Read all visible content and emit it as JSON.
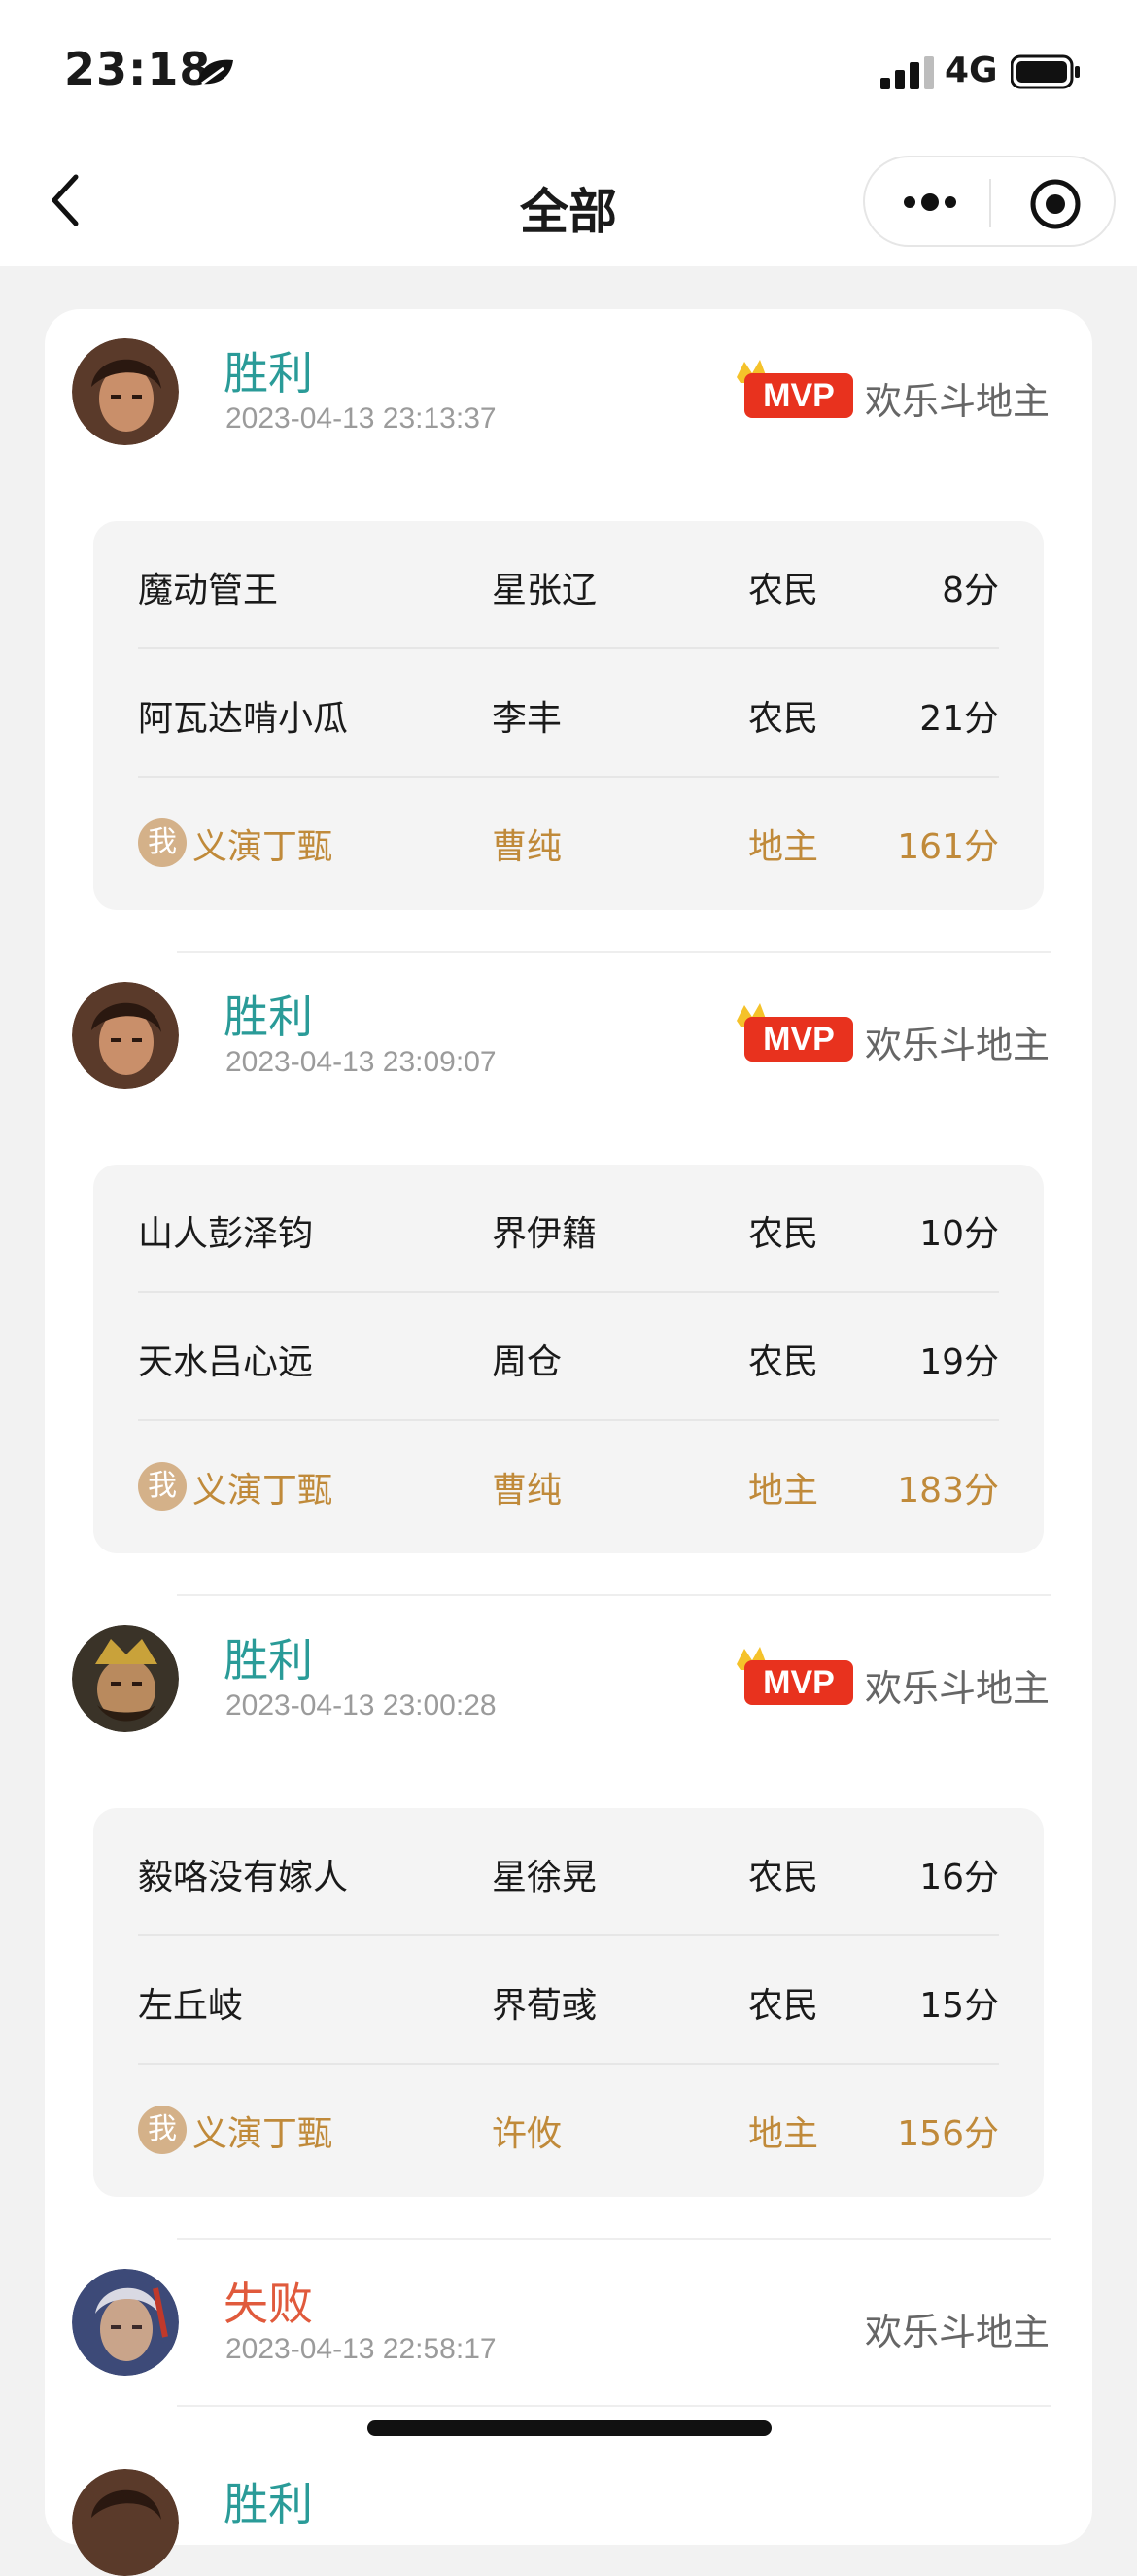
{
  "status_bar": {
    "time": "23:18",
    "network": "4G"
  },
  "nav": {
    "title": "全部"
  },
  "records": [
    {
      "result": "胜利",
      "result_type": "win",
      "datetime": "2023-04-13 23:13:37",
      "mvp": true,
      "mvp_label": "MVP",
      "mode": "欢乐斗地主",
      "rows": [
        {
          "name": "魔动管王",
          "hero": "星张辽",
          "role": "农民",
          "score": "8分"
        },
        {
          "name": "阿瓦达啃小瓜",
          "hero": "李丰",
          "role": "农民",
          "score": "21分"
        },
        {
          "me": "我",
          "name": "义演丁甄",
          "hero": "曹纯",
          "role": "地主",
          "score": "161分"
        }
      ]
    },
    {
      "result": "胜利",
      "result_type": "win",
      "datetime": "2023-04-13 23:09:07",
      "mvp": true,
      "mvp_label": "MVP",
      "mode": "欢乐斗地主",
      "rows": [
        {
          "name": "山人彭泽钧",
          "hero": "界伊籍",
          "role": "农民",
          "score": "10分"
        },
        {
          "name": "天水吕心远",
          "hero": "周仓",
          "role": "农民",
          "score": "19分"
        },
        {
          "me": "我",
          "name": "义演丁甄",
          "hero": "曹纯",
          "role": "地主",
          "score": "183分"
        }
      ]
    },
    {
      "result": "胜利",
      "result_type": "win",
      "datetime": "2023-04-13 23:00:28",
      "mvp": true,
      "mvp_label": "MVP",
      "mode": "欢乐斗地主",
      "rows": [
        {
          "name": "毅咯没有嫁人",
          "hero": "星徐晃",
          "role": "农民",
          "score": "16分"
        },
        {
          "name": "左丘岐",
          "hero": "界荀彧",
          "role": "农民",
          "score": "15分"
        },
        {
          "me": "我",
          "name": "义演丁甄",
          "hero": "许攸",
          "role": "地主",
          "score": "156分"
        }
      ]
    },
    {
      "result": "失败",
      "result_type": "lose",
      "datetime": "2023-04-13 22:58:17",
      "mvp": false,
      "mode": "欢乐斗地主",
      "rows": []
    },
    {
      "result": "胜利",
      "result_type": "win"
    }
  ],
  "colors": {
    "win": "#2a9b98",
    "lose": "#e05a3c",
    "me_row": "#c08a3a",
    "mvp_red": "#e8321e"
  }
}
